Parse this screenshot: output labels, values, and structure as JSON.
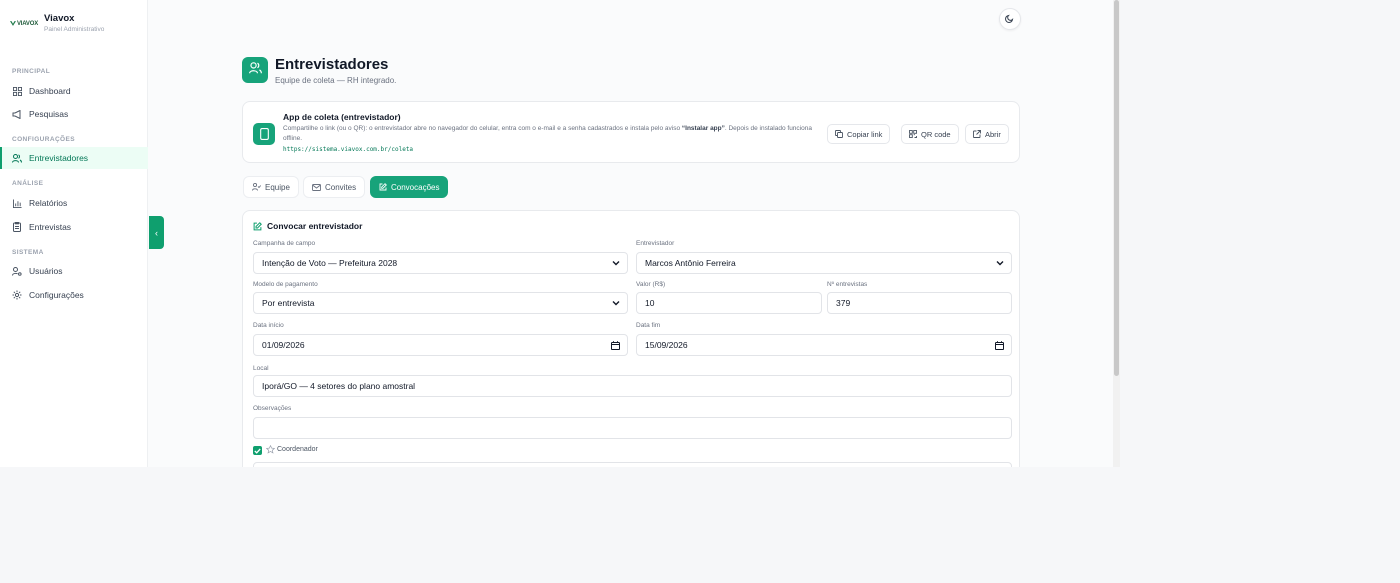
{
  "brand": {
    "name": "Viavox",
    "subtitle": "Painel Administrativo",
    "logo_text": "VIAVOX"
  },
  "nav": {
    "sections": [
      {
        "title": "PRINCIPAL",
        "items": [
          {
            "label": "Dashboard",
            "icon": "grid-icon"
          },
          {
            "label": "Pesquisas",
            "icon": "megaphone-icon"
          }
        ]
      },
      {
        "title": "CONFIGURAÇÕES",
        "items": [
          {
            "label": "Entrevistadores",
            "icon": "users-icon",
            "active": true
          }
        ]
      },
      {
        "title": "ANÁLISE",
        "items": [
          {
            "label": "Relatórios",
            "icon": "bar-chart-icon"
          },
          {
            "label": "Entrevistas",
            "icon": "clipboard-icon"
          }
        ]
      },
      {
        "title": "SISTEMA",
        "items": [
          {
            "label": "Usuários",
            "icon": "user-cog-icon"
          },
          {
            "label": "Configurações",
            "icon": "gear-icon"
          }
        ]
      }
    ]
  },
  "header": {
    "title": "Entrevistadores",
    "subtitle": "Equipe de coleta — RH integrado."
  },
  "app_card": {
    "title": "App de coleta (entrevistador)",
    "desc_before": "Compartilhe o link (ou o QR): o entrevistador abre no navegador do celular, entra com o e-mail e a senha cadastrados e instala pelo aviso ",
    "desc_bold": "“Instalar app”",
    "desc_after": ". Depois de instalado funciona offline.",
    "link": "https://sistema.viavox.com.br/coleta",
    "buttons": {
      "copy": "Copiar link",
      "qr": "QR code",
      "open": "Abrir"
    }
  },
  "tabs": [
    {
      "label": "Equipe"
    },
    {
      "label": "Convites"
    },
    {
      "label": "Convocações",
      "active": true
    }
  ],
  "form": {
    "title": "Convocar entrevistador",
    "campanha": {
      "label": "Campanha de campo",
      "value": "Intenção de Voto — Prefeitura 2028"
    },
    "entrevistador": {
      "label": "Entrevistador",
      "value": "Marcos Antônio Ferreira"
    },
    "modelo": {
      "label": "Modelo de pagamento",
      "value": "Por entrevista"
    },
    "valor": {
      "label": "Valor (R$)",
      "value": "10"
    },
    "n_entrevistas": {
      "label": "Nº entrevistas",
      "value": "379"
    },
    "data_inicio": {
      "label": "Data início",
      "value": "01/09/2026"
    },
    "data_fim": {
      "label": "Data fim",
      "value": "15/09/2026"
    },
    "local": {
      "label": "Local",
      "value": "Iporá/GO — 4 setores do plano amostral"
    },
    "observacoes": {
      "label": "Observações",
      "value": ""
    },
    "coordenador": {
      "label": "Coordenador",
      "checked": true
    }
  },
  "colors": {
    "accent": "#17a37a",
    "active_bg": "#ecfdf5"
  }
}
